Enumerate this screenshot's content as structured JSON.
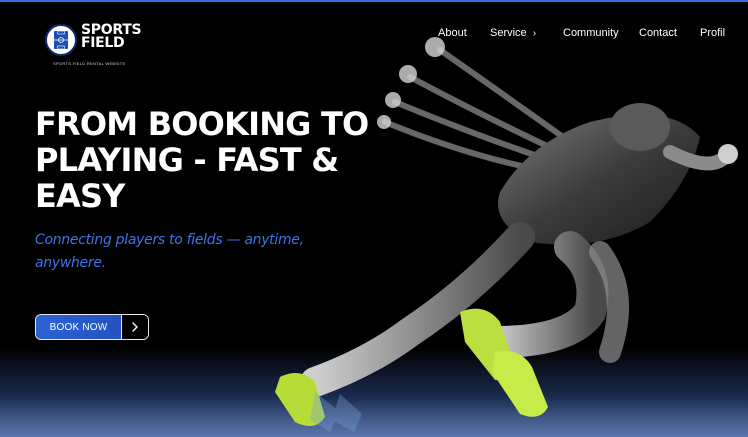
{
  "brand": {
    "name": "SPORTS FIELD",
    "tagline": "SPORTS FIELD RENTAL WEBSITE",
    "logo_icon": "soccer-field-icon",
    "primary_color": "#2b62d6",
    "accent_color": "#3a74e8"
  },
  "nav": {
    "items": [
      {
        "label": "About"
      },
      {
        "label": "Service",
        "icon": "chevron-right-icon"
      },
      {
        "label": "Community"
      },
      {
        "label": "Contact"
      },
      {
        "label": "Profil"
      }
    ]
  },
  "hero": {
    "title": "FROM BOOKING TO PLAYING - FAST & EASY",
    "subtitle": "Connecting players to fields — anytime, anywhere.",
    "cta_label": "BOOK NOW",
    "cta_icon": "chevron-right-icon",
    "image": "sprinter-photo"
  }
}
